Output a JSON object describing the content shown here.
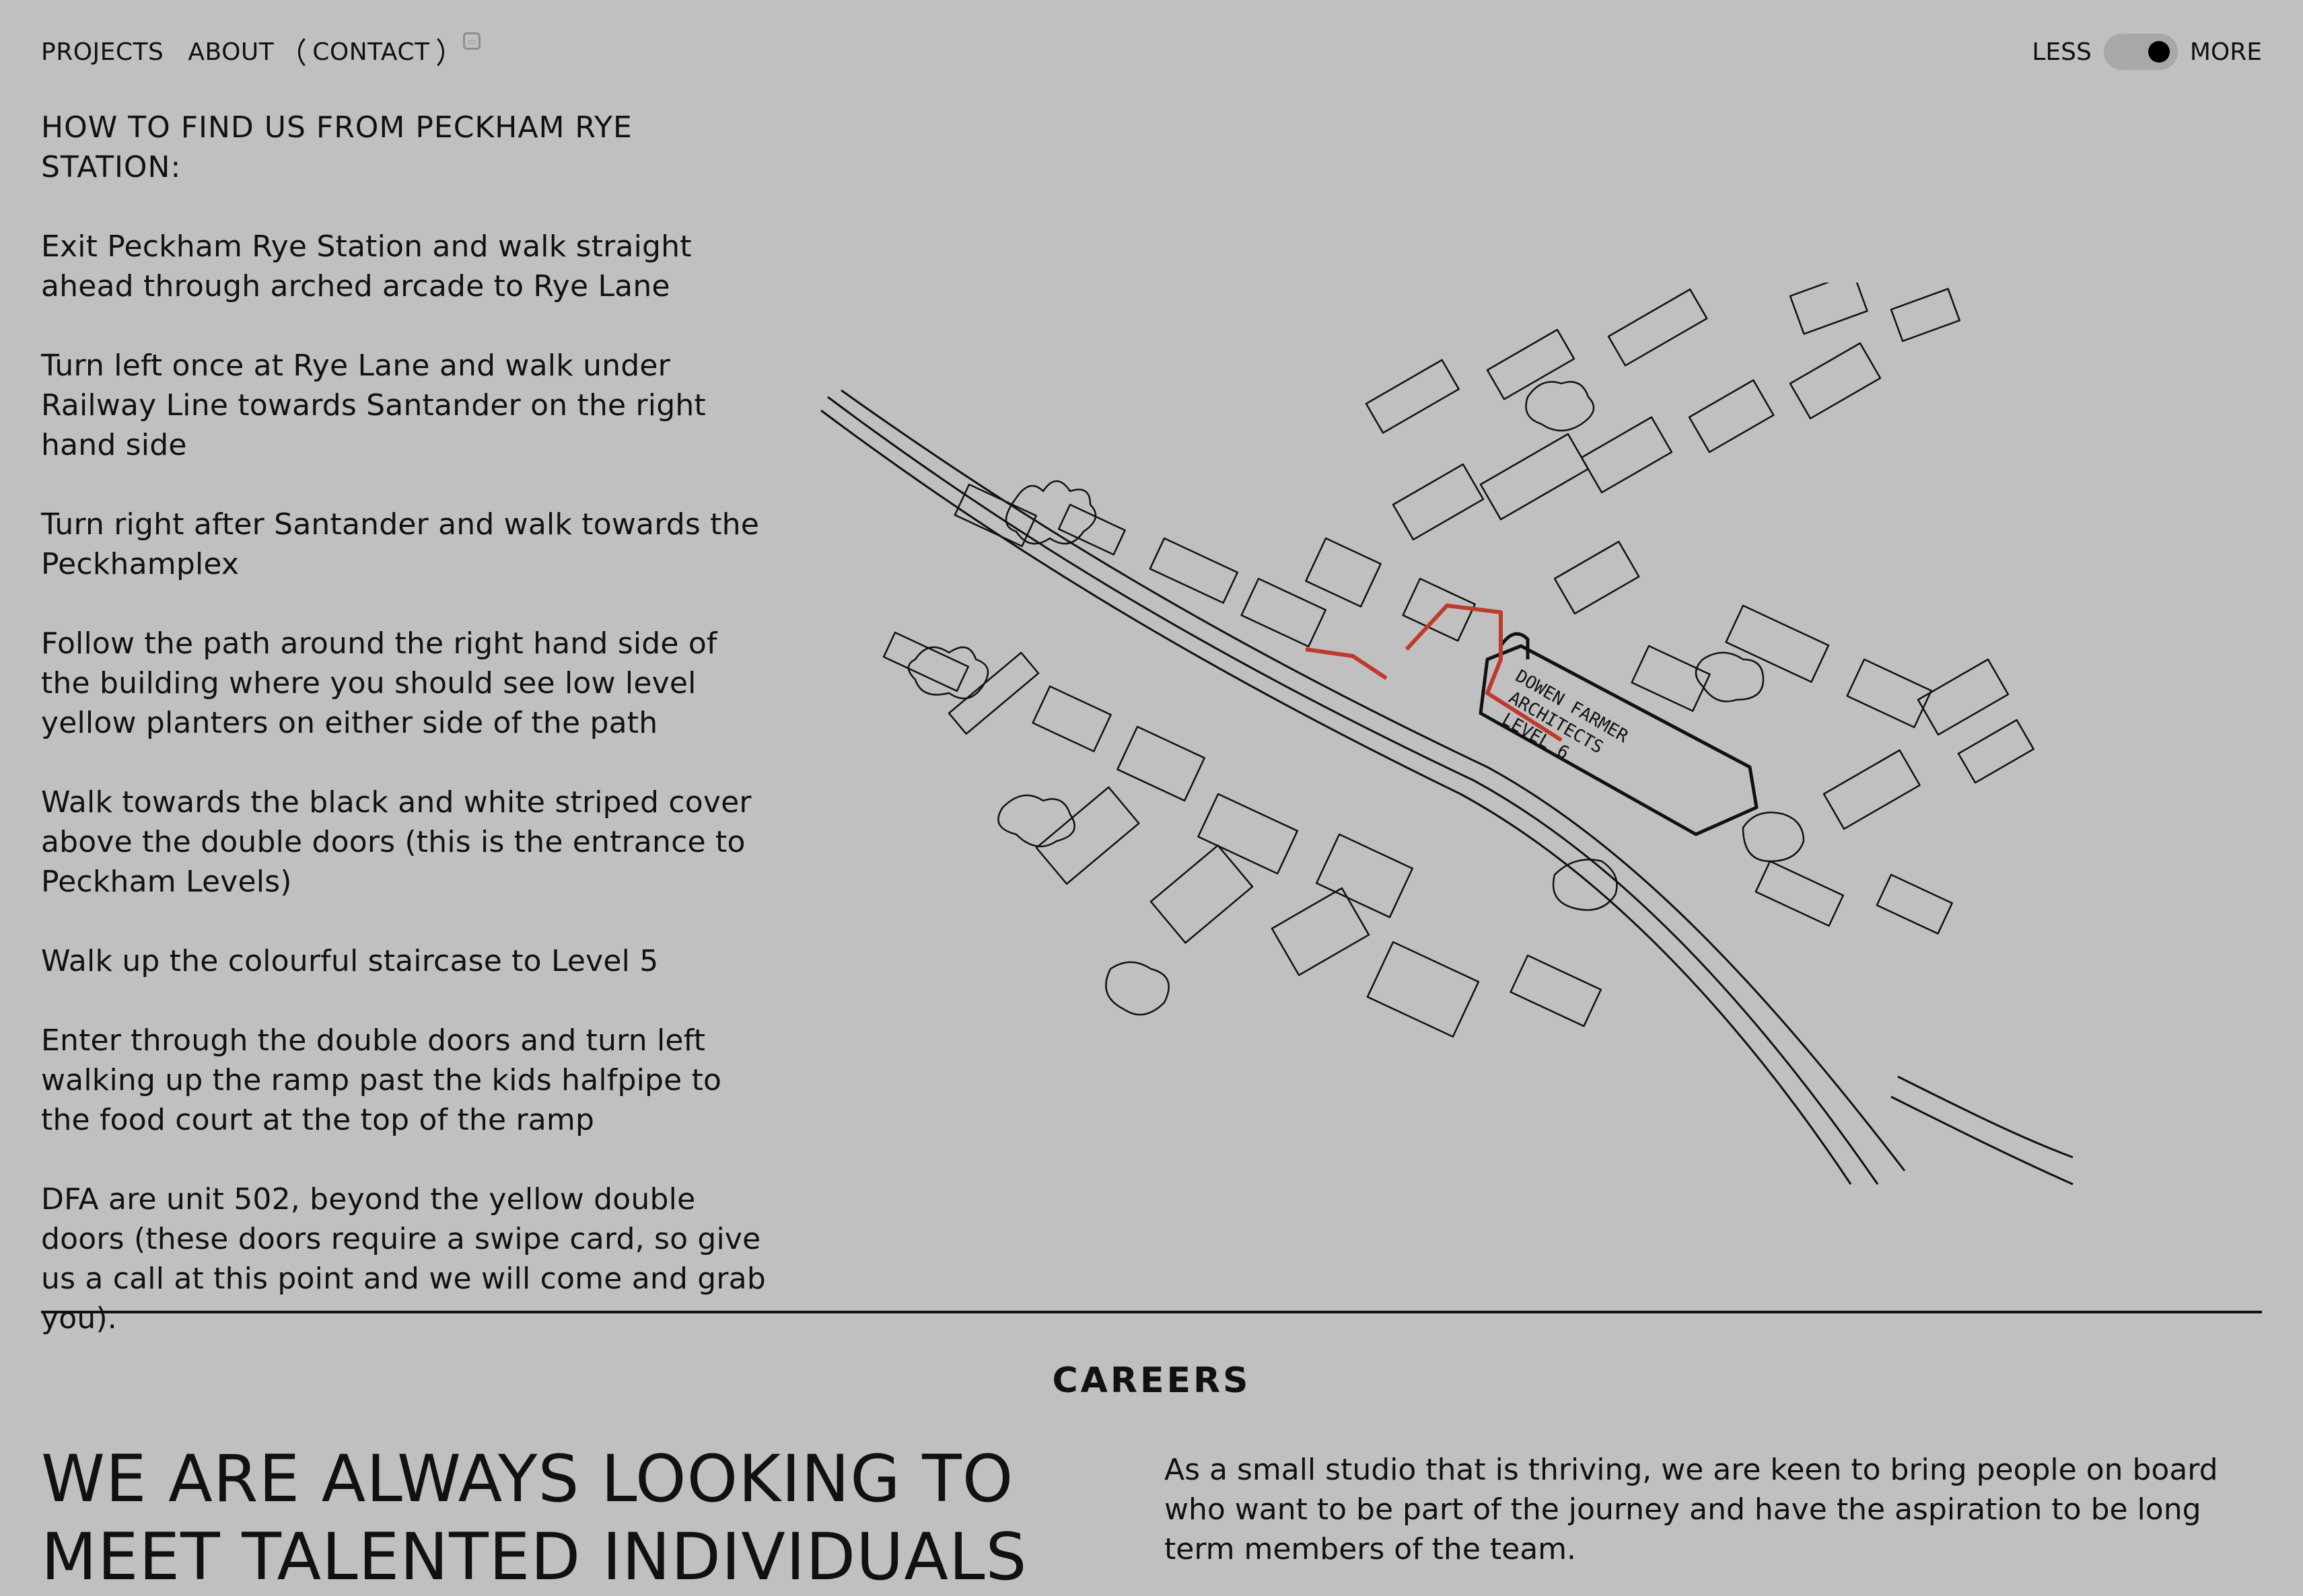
{
  "nav": {
    "projects": "PROJECTS",
    "about": "ABOUT",
    "contact": "CONTACT",
    "contact_icon": "card-icon"
  },
  "toggle": {
    "less": "LESS",
    "more": "MORE",
    "state": "more"
  },
  "directions": {
    "heading": "HOW TO FIND US FROM PECKHAM RYE STATION:",
    "steps": [
      "Exit Peckham Rye Station and walk straight ahead through arched arcade to Rye Lane",
      "Turn left once at Rye Lane and walk under Railway Line towards Santander on the right hand side",
      "Turn right after Santander and walk towards the Peckhamplex",
      "Follow the path around the right hand side of the building where you should see low level yellow planters on either side of the path",
      "Walk towards the black and white striped cover above the double doors (this is the entrance to Peckham Levels)",
      "Walk up the colourful staircase to Level 5",
      "Enter through the double doors and turn left walking up the ramp past the kids halfpipe to the food court at the top of the ramp",
      "DFA are unit 502, beyond the yellow double doors (these doors require a swipe card, so give us a call at this point and we will come and grab you)."
    ]
  },
  "map": {
    "label_lines": [
      "DOWEN FARMER",
      "ARCHITECTS",
      "LEVEL 6"
    ],
    "route_color": "#c0392b"
  },
  "careers": {
    "title": "CAREERS",
    "headline": "WE ARE ALWAYS LOOKING TO MEET TALENTED INDIVIDUALS",
    "body": "As a small studio that is thriving, we are keen to bring people on board who want to be part of the journey and have the aspiration to be long term members of the team."
  }
}
